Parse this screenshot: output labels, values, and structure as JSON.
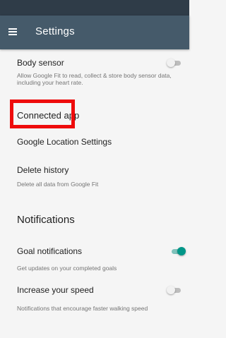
{
  "app_bar": {
    "title": "Settings",
    "menu_icon": "hamburger-menu-icon"
  },
  "settings": {
    "body_sensor": {
      "title": "Body sensor",
      "subtitle": "Allow Google Fit to read, collect & store body sensor data, including your heart rate.",
      "toggle_on": false
    },
    "connected_apps": {
      "title": "Connected app"
    },
    "location": {
      "title": "Google Location Settings"
    },
    "delete_history": {
      "title": "Delete history",
      "subtitle": "Delete all data from Google Fit"
    }
  },
  "notifications": {
    "header": "Notifications",
    "goal": {
      "title": "Goal notifications",
      "subtitle": "Get updates on your completed goals",
      "toggle_on": true
    },
    "speed": {
      "title": "Increase your speed",
      "subtitle": "Notifications that encourage faster walking speed",
      "toggle_on": false
    }
  },
  "colors": {
    "status_bar": "#2f3c48",
    "app_bar": "#455a6a",
    "accent": "#009688",
    "highlight": "#ee0b0b"
  }
}
